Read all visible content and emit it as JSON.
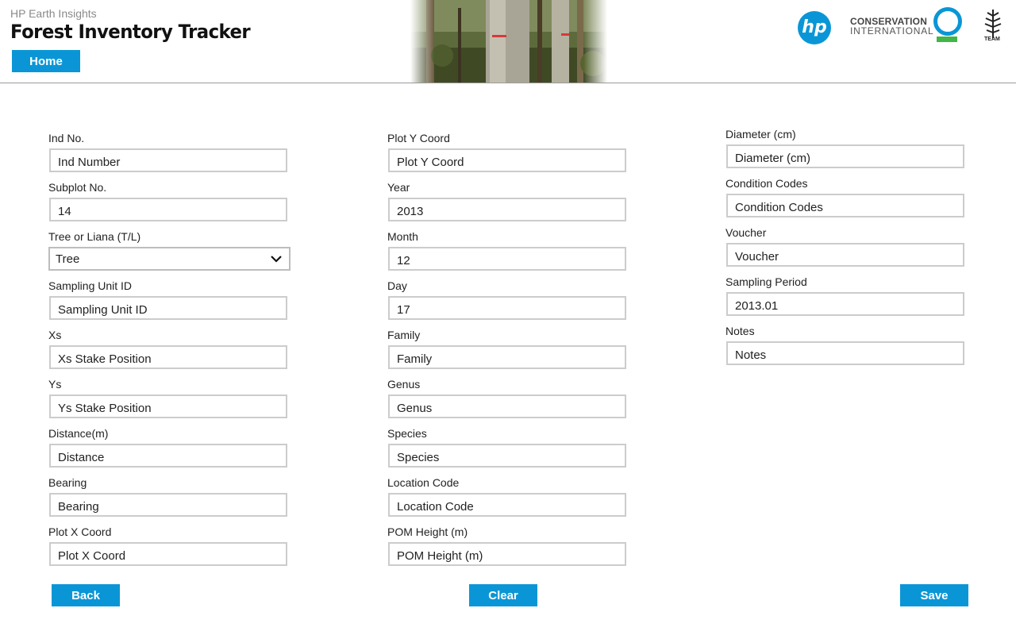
{
  "header": {
    "subtitle": "HP Earth Insights",
    "title": "Forest Inventory Tracker",
    "home_label": "Home",
    "partner_line1": "CONSERVATION",
    "partner_line2": "INTERNATIONAL",
    "hp_text": "hp",
    "team_text": "TEAM"
  },
  "columns": [
    [
      {
        "label": "Ind No.",
        "value": "Ind Number"
      },
      {
        "label": "Subplot No.",
        "value": "14"
      },
      {
        "label": "Tree or Liana (T/L)",
        "value": "Tree",
        "type": "select"
      },
      {
        "label": "Sampling Unit ID",
        "value": "Sampling Unit ID"
      },
      {
        "label": "Xs",
        "value": "Xs Stake Position"
      },
      {
        "label": "Ys",
        "value": "Ys Stake Position"
      },
      {
        "label": "Distance(m)",
        "value": "Distance"
      },
      {
        "label": "Bearing",
        "value": "Bearing"
      },
      {
        "label": "Plot X Coord",
        "value": "Plot X Coord"
      }
    ],
    [
      {
        "label": "Plot Y Coord",
        "value": "Plot Y Coord"
      },
      {
        "label": "Year",
        "value": "2013"
      },
      {
        "label": "Month",
        "value": "12"
      },
      {
        "label": "Day",
        "value": "17"
      },
      {
        "label": "Family",
        "value": "Family"
      },
      {
        "label": "Genus",
        "value": "Genus"
      },
      {
        "label": "Species",
        "value": "Species"
      },
      {
        "label": "Location Code",
        "value": "Location Code"
      },
      {
        "label": "POM Height (m)",
        "value": "POM Height (m)"
      }
    ],
    [
      {
        "label": "Diameter (cm)",
        "value": "Diameter (cm)"
      },
      {
        "label": "Condition Codes",
        "value": "Condition Codes"
      },
      {
        "label": "Voucher",
        "value": "Voucher"
      },
      {
        "label": "Sampling Period",
        "value": "2013.01"
      },
      {
        "label": "Notes",
        "value": "Notes"
      }
    ]
  ],
  "actions": {
    "back": "Back",
    "clear": "Clear",
    "save": "Save"
  },
  "colors": {
    "accent": "#0a96d6",
    "ci_green": "#43b649"
  }
}
